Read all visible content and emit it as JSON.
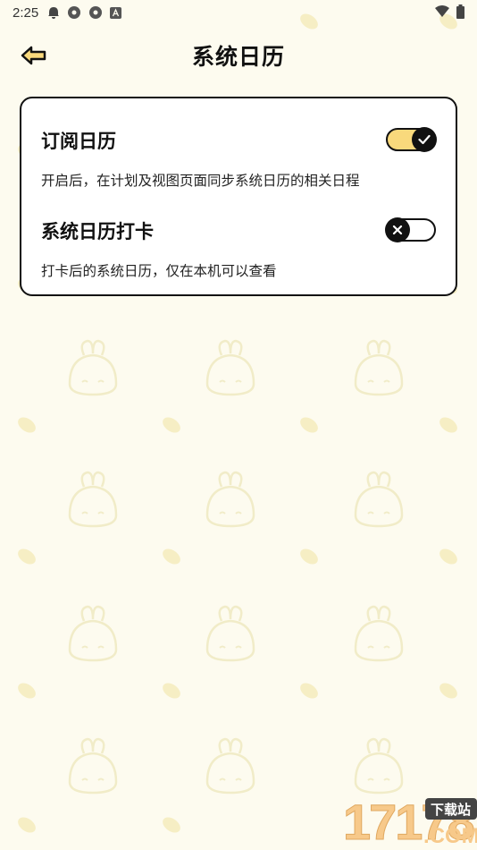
{
  "status_bar": {
    "time": "2:25",
    "icons": [
      "notification-bell-icon",
      "app-icon",
      "app-icon",
      "a-box-icon"
    ],
    "right_icons": [
      "wifi-icon",
      "battery-icon"
    ]
  },
  "header": {
    "title": "系统日历",
    "back_icon": "back-arrow-icon"
  },
  "settings": [
    {
      "title": "订阅日历",
      "description": "开启后，在计划及视图页面同步系统日历的相关日程",
      "enabled": true
    },
    {
      "title": "系统日历打卡",
      "description": "打卡后的系统日历，仅在本机可以查看",
      "enabled": false
    }
  ],
  "colors": {
    "background": "#fdfbef",
    "toggle_on": "#f9d97c",
    "accent_dark": "#111111"
  },
  "watermark": {
    "text": "17178",
    "domain": ".COM",
    "badge": "下载站"
  }
}
